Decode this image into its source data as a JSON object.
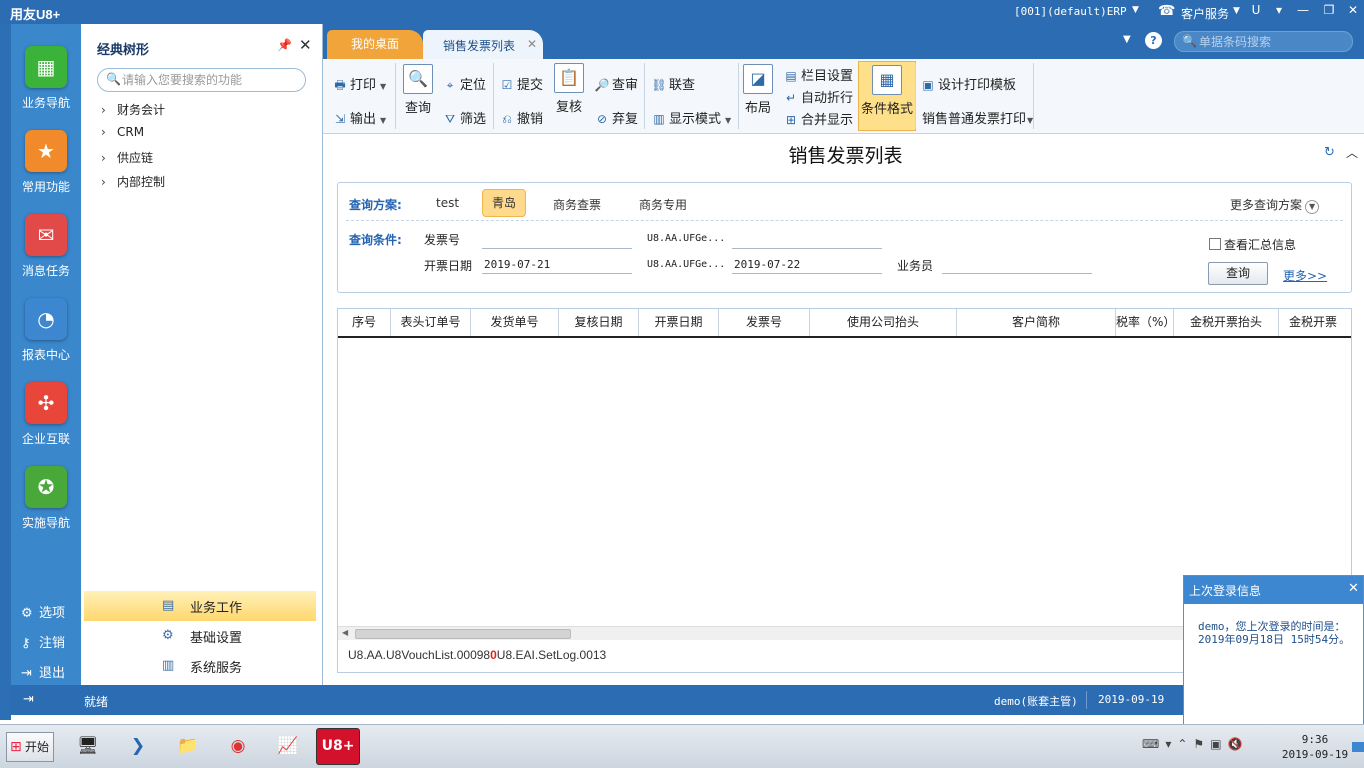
{
  "titlebar": {
    "logo": "用友U8+",
    "connection": "[001](default)ERP",
    "customer_service": "客户服务",
    "u_icon": "U",
    "dropdown_icon": "▾",
    "minimize": "—",
    "restore": "❐",
    "close": "✕"
  },
  "left_nav": {
    "items": [
      {
        "label": "业务导航",
        "color": "#3bb33b"
      },
      {
        "label": "常用功能",
        "color": "#f08a2a"
      },
      {
        "label": "消息任务",
        "color": "#e24a4a"
      },
      {
        "label": "报表中心",
        "color": "#3d86d0"
      },
      {
        "label": "企业互联",
        "color": "#e8463a"
      },
      {
        "label": "实施导航",
        "color": "#48a83a"
      }
    ],
    "bottom": [
      "选项",
      "注销",
      "退出"
    ]
  },
  "tree": {
    "title": "经典树形",
    "search_placeholder": "请输入您要搜索的功能",
    "nodes": [
      "财务会计",
      "CRM",
      "供应链",
      "内部控制"
    ],
    "menu": [
      "业务工作",
      "基础设置",
      "系统服务"
    ]
  },
  "tabs": {
    "desktop": "我的桌面",
    "invoice_list": "销售发票列表",
    "barcode_placeholder": "单据条码搜索"
  },
  "toolbar": {
    "print": "打印",
    "export": "输出",
    "query": "查询",
    "locate": "定位",
    "filter": "筛选",
    "submit": "提交",
    "revoke": "撤销",
    "recheck": "复核",
    "review": "查审",
    "discard": "弃复",
    "linked_query": "联查",
    "display_mode": "显示模式",
    "layout": "布局",
    "column_settings": "栏目设置",
    "auto_wrap": "自动折行",
    "merge_display": "合并显示",
    "condition_format": "条件格式",
    "design_print_template": "设计打印模板",
    "print_template_select": "销售普通发票打印"
  },
  "page": {
    "title": "销售发票列表"
  },
  "query_panel": {
    "scheme_label": "查询方案:",
    "schemes": [
      "test",
      "青岛",
      "商务查票",
      "商务专用"
    ],
    "active_scheme": "青岛",
    "more_schemes": "更多查询方案",
    "condition_label": "查询条件:",
    "invoice_no_label": "发票号",
    "invoice_no_value": "",
    "field2_label": "U8.AA.UFGe...",
    "field2_value": "",
    "invoice_date_label": "开票日期",
    "invoice_date_from": "2019-07-21",
    "field4_label": "U8.AA.UFGe...",
    "invoice_date_to": "2019-07-22",
    "salesman_label": "业务员",
    "salesman_value": "",
    "summary_checkbox": "查看汇总信息",
    "query_button": "查询",
    "more_link": "更多>>"
  },
  "grid": {
    "columns": [
      "序号",
      "表头订单号",
      "发货单号",
      "复核日期",
      "开票日期",
      "发票号",
      "使用公司抬头",
      "客户简称",
      "税率（%）",
      "金税开票抬头",
      "金税开票"
    ],
    "rows": [],
    "status_left": "U8.AA.U8VouchList.00098",
    "status_right": "U8.EAI.SetLog.0013"
  },
  "statusbar": {
    "ready": "就绪",
    "user": "demo(账套主管)",
    "date": "2019-09-19"
  },
  "popup": {
    "title": "上次登录信息",
    "message": "demo，您上次登录的时间是：2019年09月18日 15时54分。"
  },
  "taskbar": {
    "start": "开始",
    "u8_label": "U8+",
    "time": "9:36",
    "date": "2019-09-19"
  }
}
